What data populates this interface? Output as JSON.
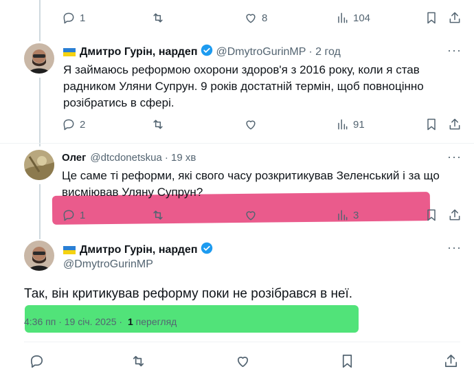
{
  "tweet1_actions": {
    "replies": "1",
    "retweets": "",
    "likes": "8",
    "views": "104"
  },
  "tweet2": {
    "name": "Дмитро Гурін, нардеп",
    "handle": "@DmytroGurinMP",
    "time": "· 2 год",
    "text_line1": "Я займаюсь реформою охорони здоров'я з 2016 року, коли я став",
    "text_line2": "радником Уляни Супрун. 9 років достатній термін, щоб повноцінно",
    "text_line3": "розібратись в сфері.",
    "replies": "2",
    "views": "91"
  },
  "tweet3": {
    "name": "Олег",
    "handle": "@dtcdonetskua",
    "time": "· 19 хв",
    "text_line1": "Це саме ті реформи, які свого часу розкритикував Зеленський і за що",
    "text_line2": "висміював Уляну Супрун?",
    "replies": "1",
    "views": "3"
  },
  "tweet4": {
    "name": "Дмитро Гурін, нардеп",
    "handle": "@DmytroGurinMP",
    "text": "Так, він критикував реформу поки не розібрався в неї.",
    "time": "4:36 пп · 19 січ. 2025 ·",
    "views_count": "1",
    "views_label": "перегляд"
  },
  "menu_glyph": "···",
  "colors": {
    "pink_highlight": "#e8497f",
    "green_highlight": "#3ee06a",
    "verified_blue": "#1d9bf0",
    "muted": "#536471"
  }
}
